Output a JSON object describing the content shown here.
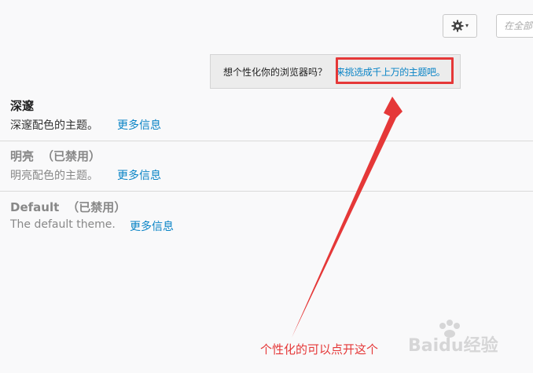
{
  "toolbar": {
    "gear_icon": "gear-icon",
    "search_placeholder": "在全部"
  },
  "promo": {
    "question": "想个性化你的浏览器吗？",
    "link": "来挑选成千上万的主题吧。"
  },
  "themes": [
    {
      "name": "深邃",
      "status": "",
      "description": "深邃配色的主题。",
      "more": "更多信息"
    },
    {
      "name": "明亮",
      "status": "（已禁用）",
      "description": "明亮配色的主题。",
      "more": "更多信息"
    },
    {
      "name": "Default",
      "status": "（已禁用）",
      "description": "The default theme.",
      "more": "更多信息"
    }
  ],
  "annotation": {
    "text": "个性化的可以点开这个",
    "color": "#e53838"
  },
  "watermark": {
    "text": "Baidu经验",
    "icon": "paw-icon"
  },
  "colors": {
    "link": "#0a84c6",
    "annotation_red": "#e53838",
    "background": "#f9f9fa"
  }
}
